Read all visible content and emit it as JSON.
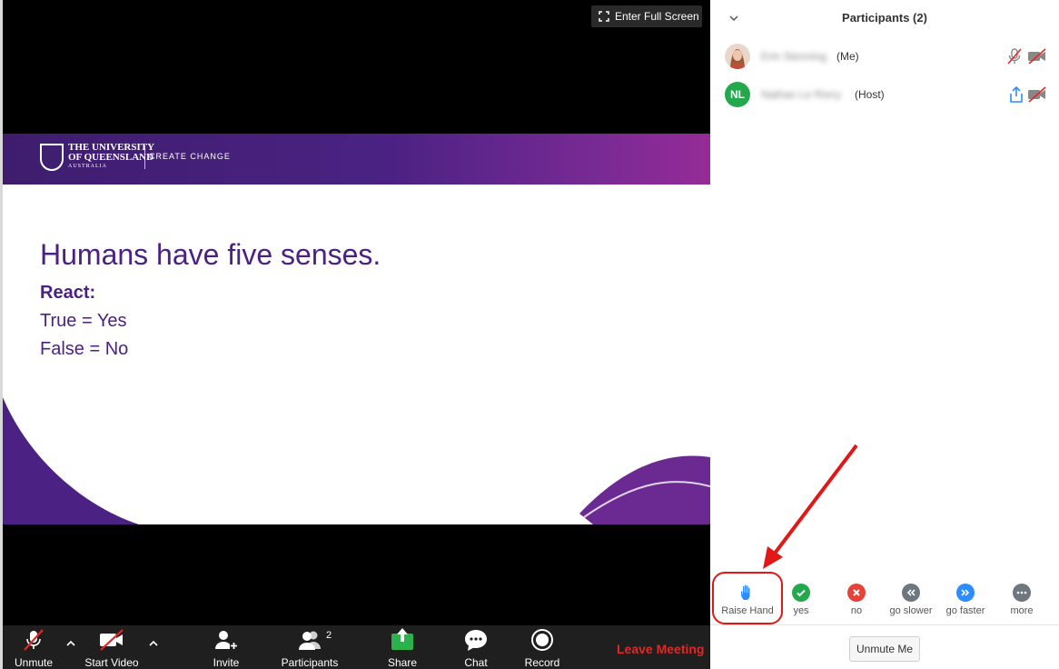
{
  "video": {
    "fullscreen_label": "Enter Full Screen"
  },
  "slide": {
    "university_line1": "THE UNIVERSITY",
    "university_line2": "OF QUEENSLAND",
    "university_line3": "AUSTRALIA",
    "tagline": "CREATE CHANGE",
    "title": "Humans have five senses.",
    "react_label": "React:",
    "line_true": "True = Yes",
    "line_false": "False = No"
  },
  "toolbar": {
    "unmute_label": "Unmute",
    "start_video_label": "Start Video",
    "invite_label": "Invite",
    "participants_label": "Participants",
    "participants_count": "2",
    "share_label": "Share",
    "chat_label": "Chat",
    "record_label": "Record",
    "leave_label": "Leave Meeting"
  },
  "panel": {
    "title": "Participants (2)",
    "participants": [
      {
        "name": "Erin Stenning",
        "role": "(Me)",
        "initials": ""
      },
      {
        "name": "Nathan Le Rorry",
        "role": "(Host)",
        "initials": "NL"
      }
    ],
    "reactions": [
      {
        "label": "Raise Hand",
        "icon": "raise-hand-icon",
        "color": "#2d8cff"
      },
      {
        "label": "yes",
        "icon": "check-icon",
        "color": "#23a84b"
      },
      {
        "label": "no",
        "icon": "x-icon",
        "color": "#e5433a"
      },
      {
        "label": "go slower",
        "icon": "rewind-icon",
        "color": "#6e7680"
      },
      {
        "label": "go faster",
        "icon": "fast-forward-icon",
        "color": "#2d8cff"
      },
      {
        "label": "more",
        "icon": "more-icon",
        "color": "#6e7680"
      }
    ],
    "unmute_me_label": "Unmute Me"
  },
  "colors": {
    "brand_purple": "#4b2283",
    "leave_red": "#e02828",
    "annotation_red": "#e01818",
    "zoom_blue": "#2d8cff"
  }
}
